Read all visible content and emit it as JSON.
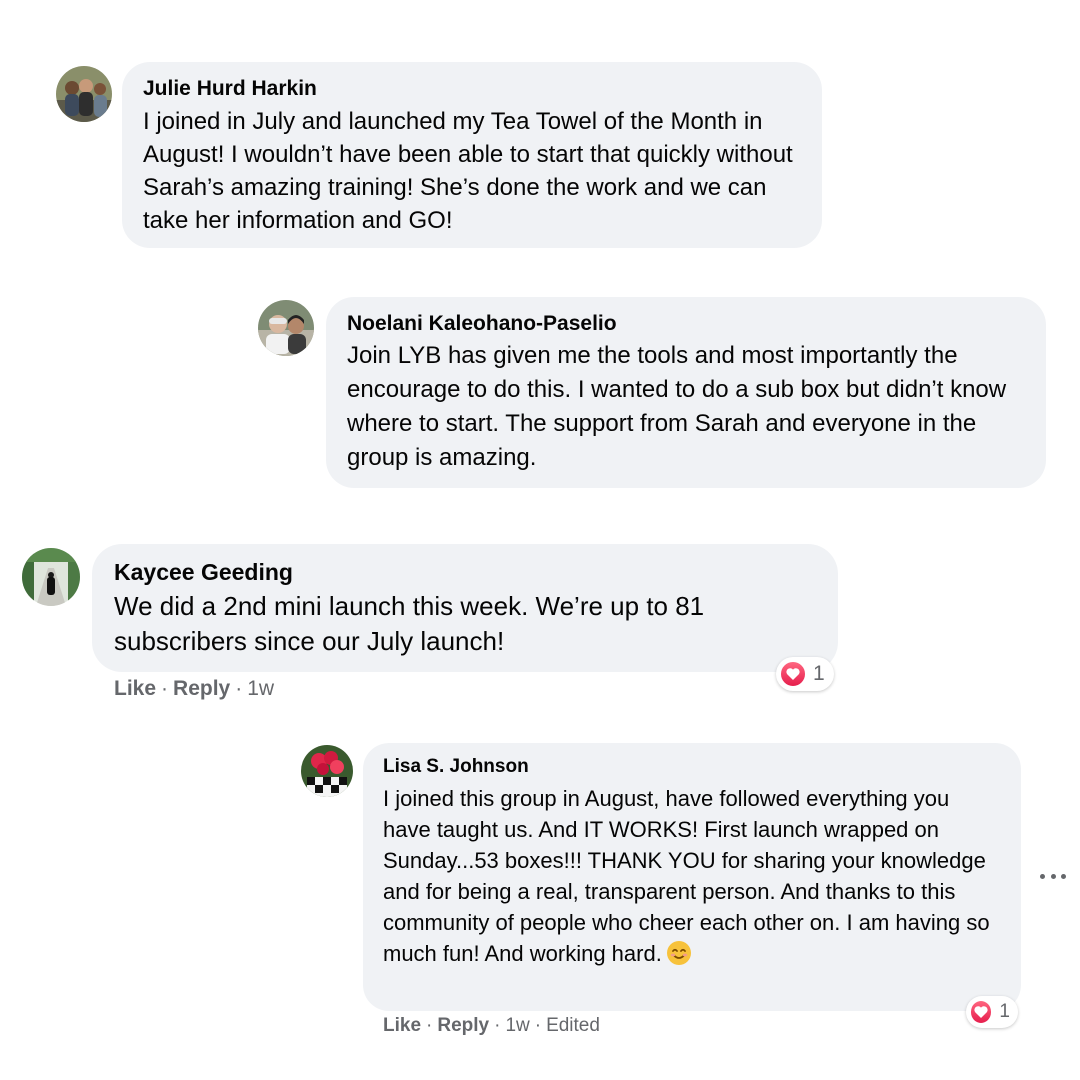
{
  "comments": [
    {
      "author": "Julie Hurd Harkin",
      "text": "I joined in July and launched my Tea Towel of the Month in August! I wouldn’t have been able to start that quickly without Sarah’s amazing training! She’s done the work and we can take her information and GO!"
    },
    {
      "author": "Noelani Kaleohano-Paselio",
      "text": "Join LYB has given me the tools and most importantly the encourage to do this. I wanted to do a sub box but didn’t know where to start. The support from Sarah and everyone in the group is amazing."
    },
    {
      "author": "Kaycee Geeding",
      "text": "We did a 2nd mini launch this week. We’re up to 81 subscribers since our July launch!",
      "like_label": "Like",
      "reply_label": "Reply",
      "time": "1w",
      "reaction_count": "1"
    },
    {
      "author": "Lisa S. Johnson",
      "text": "I joined this group in August, have followed everything you have taught us. And IT WORKS! First launch wrapped on Sunday...53 boxes!!! THANK YOU for sharing your knowledge and for being a real, transparent person. And thanks to this community of people who cheer each other on. I am having so much fun! And working hard.",
      "emoji": "smiling-face-emoji",
      "like_label": "Like",
      "reply_label": "Reply",
      "time": "1w",
      "edited": "Edited",
      "reaction_count": "1"
    }
  ],
  "separator": "·",
  "icons": {
    "reaction": "heart-reaction-icon",
    "more": "more-options-icon"
  },
  "colors": {
    "bubble": "#f0f2f5",
    "meta": "#65676b",
    "heart": "#f33e58"
  }
}
